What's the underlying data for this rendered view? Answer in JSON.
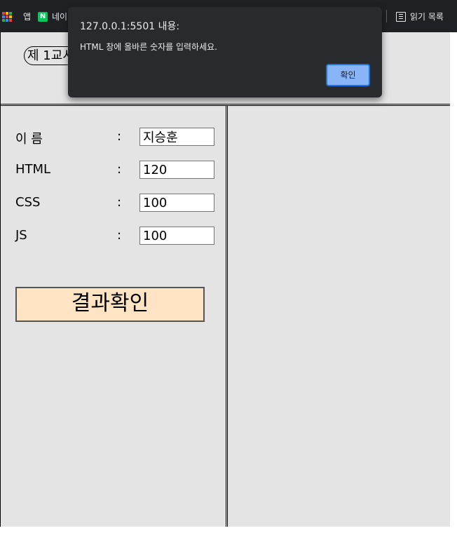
{
  "bookmarks": {
    "apps_label": "앱",
    "naver_badge": "N",
    "naver_label": "네이",
    "reading_list_label": "읽기 목록"
  },
  "page": {
    "title": "제 1교시",
    "form": {
      "name": {
        "label": "이 름",
        "colon": ":",
        "value": "지승훈"
      },
      "html": {
        "label": "HTML",
        "colon": ":",
        "value": "120"
      },
      "css": {
        "label": "CSS",
        "colon": ":",
        "value": "100"
      },
      "js": {
        "label": "JS",
        "colon": ":",
        "value": "100"
      }
    },
    "result_button": "결과확인"
  },
  "dialog": {
    "title": "127.0.0.1:5501 내용:",
    "message": "HTML 창에 올바른 숫자를 입력하세요.",
    "ok_label": "확인"
  }
}
